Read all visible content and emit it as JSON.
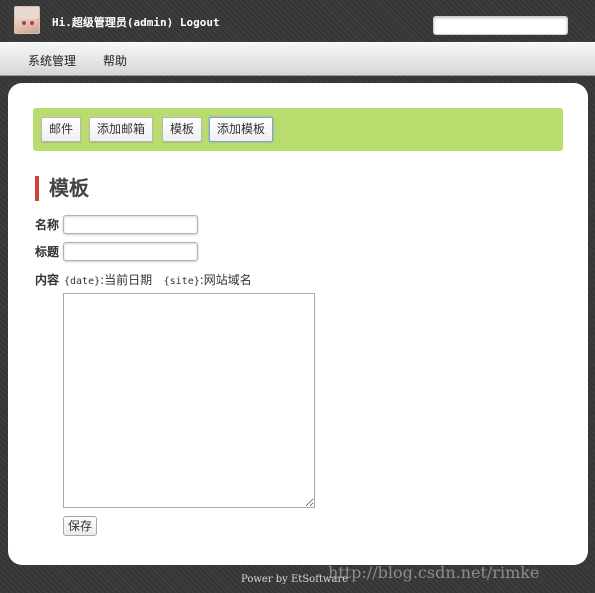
{
  "header": {
    "user_text": "Hi.超级管理员(admin) Logout",
    "search_value": ""
  },
  "menu": {
    "items": [
      {
        "label": "系统管理"
      },
      {
        "label": "帮助"
      }
    ]
  },
  "toolbar": {
    "buttons": [
      {
        "label": "邮件"
      },
      {
        "label": "添加邮箱"
      },
      {
        "label": "模板"
      },
      {
        "label": "添加模板"
      }
    ]
  },
  "page": {
    "title": "模板"
  },
  "form": {
    "name_label": "名称",
    "name_value": "",
    "subject_label": "标题",
    "subject_value": "",
    "content_label": "内容",
    "hint_date_code": "{date}",
    "hint_date_text": ":当前日期",
    "hint_site_code": "{site}",
    "hint_site_text": ":网站域名",
    "content_value": "",
    "save_label": "保存"
  },
  "footer": {
    "text": "Power by EtSoftware",
    "watermark": "http://blog.csdn.net/rimke"
  },
  "colors": {
    "accent_green": "#b9dc6e",
    "title_bar_red": "#d0433f",
    "active_button_border": "#7fa3d6"
  }
}
